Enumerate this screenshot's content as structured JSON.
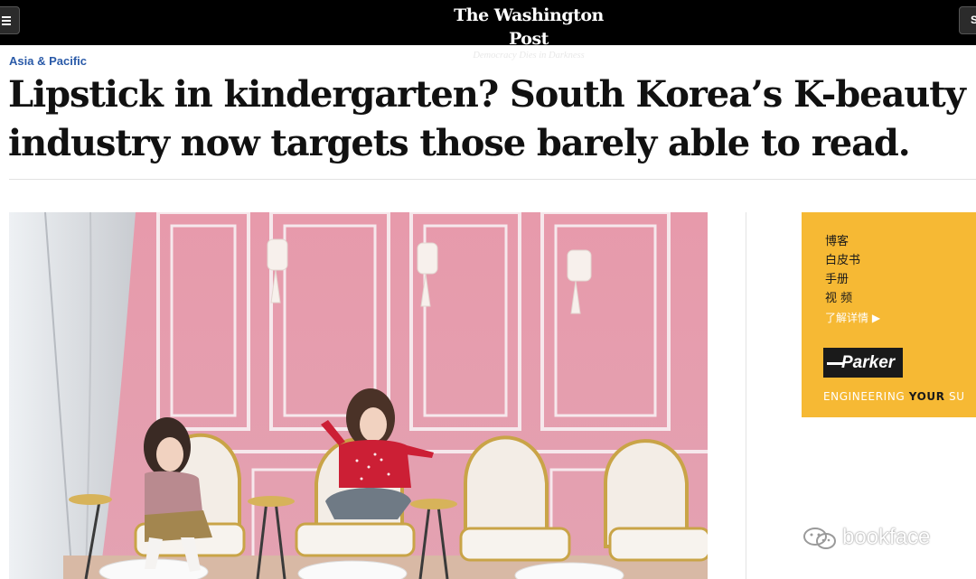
{
  "masthead": {
    "logo": "The Washington Post",
    "slogan": "Democracy Dies in Darkness",
    "subscribe_label": "S"
  },
  "article": {
    "section": "Asia & Pacific",
    "headline_line1": "Lipstick in kindergarten? South Korea’s K-beauty",
    "headline_line2": "industry now targets those barely able to read."
  },
  "ad": {
    "items": [
      "博客",
      "白皮书",
      "手册",
      "视 频"
    ],
    "more": "了解详情 ▶",
    "brand": "Parker",
    "tagline_prefix": "ENGINEERING ",
    "tagline_highlight": "YOUR",
    "tagline_suffix": " SU",
    "background": "#f6b934"
  },
  "watermark": {
    "text": "bookface"
  },
  "colors": {
    "topbar": "#000000",
    "section_link": "#2a5aa8",
    "headline": "#111111"
  }
}
